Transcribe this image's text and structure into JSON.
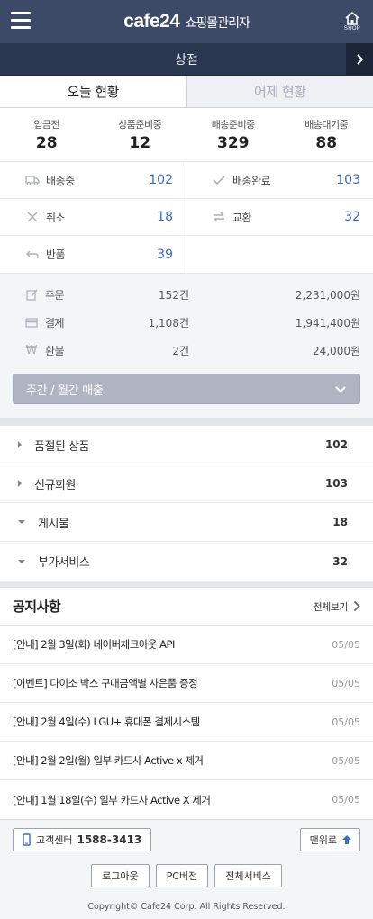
{
  "header": {
    "logo": "cafe24",
    "subtitle": "쇼핑몰관리자",
    "shop_label": "SHOP"
  },
  "store": {
    "name": "상점"
  },
  "tabs": [
    {
      "label": "오늘 현황",
      "active": true
    },
    {
      "label": "어제 현황",
      "active": false
    }
  ],
  "order_counts": [
    {
      "label": "입금전",
      "value": "28"
    },
    {
      "label": "상품준비중",
      "value": "12"
    },
    {
      "label": "배송준비중",
      "value": "329"
    },
    {
      "label": "배송대기중",
      "value": "88"
    }
  ],
  "status_grid": [
    {
      "label": "배송중",
      "value": "102",
      "icon": "truck-icon"
    },
    {
      "label": "배송완료",
      "value": "103",
      "icon": "check-icon"
    },
    {
      "label": "취소",
      "value": "18",
      "icon": "cancel-x-icon"
    },
    {
      "label": "교환",
      "value": "32",
      "icon": "exchange-arrows-icon"
    },
    {
      "label": "반품",
      "value": "39",
      "icon": "return-arrow-icon"
    }
  ],
  "sales": [
    {
      "label": "주문",
      "count": "152건",
      "amount": "2,231,000원",
      "icon": "edit-icon"
    },
    {
      "label": "결제",
      "count": "1,108건",
      "amount": "1,941,400원",
      "icon": "card-icon"
    },
    {
      "label": "환불",
      "count": "2건",
      "amount": "24,000원",
      "icon": "won-icon"
    }
  ],
  "sales_button": {
    "label": "주간 / 월간 매출"
  },
  "links": [
    {
      "label": "품절된 상품",
      "value": "102",
      "expanded": false
    },
    {
      "label": "신규회원",
      "value": "103",
      "expanded": false
    },
    {
      "label": "게시물",
      "value": "18",
      "expanded": true
    },
    {
      "label": "부가서비스",
      "value": "32",
      "expanded": true
    }
  ],
  "notices": {
    "title": "공지사항",
    "more_label": "전체보기",
    "items": [
      {
        "text": "[안내] 2월 3일(화) 네이버체크아웃 API",
        "date": "05/05"
      },
      {
        "text": "[이벤트] 다이소 박스 구매금액별 사은품 증정",
        "date": "05/05"
      },
      {
        "text": "[안내] 2월 4일(수) LGU+ 휴대폰 결제시스템",
        "date": "05/05"
      },
      {
        "text": "[안내] 2월 2일(월) 일부 카드사 Active x 제거",
        "date": "05/05"
      },
      {
        "text": "[안내] 1월 18일(수) 일부 카드사 Active X 제거",
        "date": "05/05"
      }
    ]
  },
  "footer": {
    "cs_label": "고객센터",
    "cs_phone": "1588-3413",
    "top_label": "맨위로",
    "buttons": [
      "로그아웃",
      "PC버전",
      "전체서비스"
    ],
    "copyright": "Copyright© Cafe24 Corp. All Rights Reserved."
  },
  "colors": {
    "header_bg": "#3d4a67",
    "store_bar_bg": "#2a3750",
    "link_blue": "#3b6cc8",
    "sales_button_bg": "#aeb4c2"
  }
}
